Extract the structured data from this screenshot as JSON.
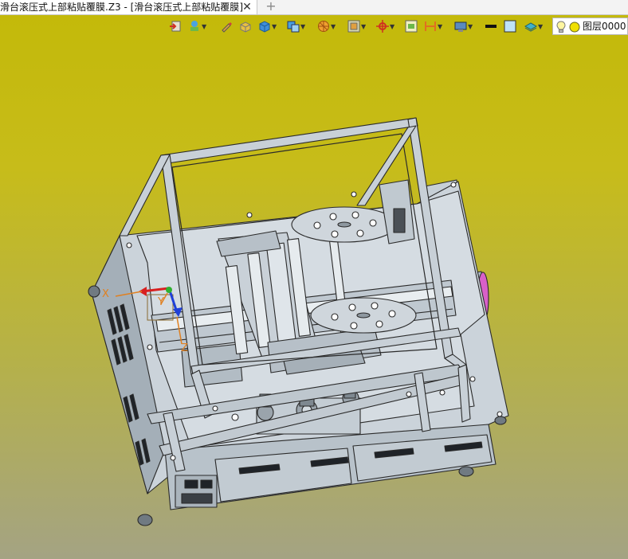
{
  "tab": {
    "title": "滑台滚压式上部粘贴覆膜.Z3 - [滑台滚压式上部粘贴覆膜]",
    "close_symbol": "✕",
    "add_symbol": "+"
  },
  "toolbar": {
    "items": [
      {
        "icon": "import-icon"
      },
      {
        "icon": "shape-tool-icon"
      },
      {
        "icon": "pencil-icon"
      },
      {
        "icon": "solid-block-icon"
      },
      {
        "icon": "cube-view-icon"
      },
      {
        "icon": "display-mode-icon"
      },
      {
        "icon": "render-mode-icon"
      },
      {
        "icon": "section-view-icon"
      },
      {
        "icon": "axis-move-icon"
      },
      {
        "icon": "fit-view-icon"
      },
      {
        "icon": "measure-icon"
      },
      {
        "icon": "screen-capture-icon"
      },
      {
        "icon": "line-color-icon"
      },
      {
        "icon": "face-color-icon"
      },
      {
        "icon": "layer-display-icon"
      }
    ],
    "layer_label": "图层0000"
  },
  "viewport": {
    "triad": {
      "x_label": "X",
      "y_label": "Y",
      "z_label": "Z"
    }
  },
  "colors": {
    "background_top": "#c3b908",
    "background_bottom": "#a4a383",
    "model_face": "#cdd5dc",
    "model_edge": "#2a2a2a",
    "handle_accent": "#d860c8"
  }
}
